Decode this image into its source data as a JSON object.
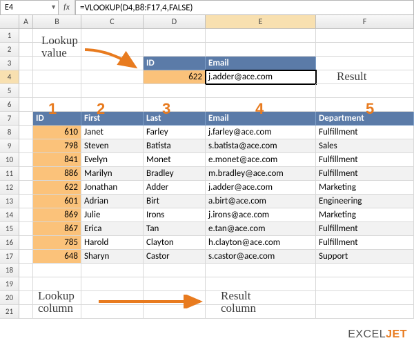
{
  "name_box": "E4",
  "fx_label": "fx",
  "formula": "=VLOOKUP(D4,B8:F17,4,FALSE)",
  "columns": [
    "A",
    "B",
    "C",
    "D",
    "E",
    "F"
  ],
  "row_count": 21,
  "active_col": "E",
  "active_row": 4,
  "lookup_header": {
    "id": "ID",
    "email": "Email"
  },
  "lookup_value": "622",
  "lookup_result": "j.adder@ace.com",
  "col_numbers": [
    "1",
    "2",
    "3",
    "4",
    "5"
  ],
  "table": {
    "headers": [
      "ID",
      "First",
      "Last",
      "Email",
      "Department"
    ],
    "rows": [
      {
        "id": "610",
        "first": "Janet",
        "last": "Farley",
        "email": "j.farley@ace.com",
        "dept": "Fulfillment"
      },
      {
        "id": "798",
        "first": "Steven",
        "last": "Batista",
        "email": "s.batista@ace.com",
        "dept": "Sales"
      },
      {
        "id": "841",
        "first": "Evelyn",
        "last": "Monet",
        "email": "e.monet@ace.com",
        "dept": "Fulfillment"
      },
      {
        "id": "886",
        "first": "Marilyn",
        "last": "Bradley",
        "email": "m.bradley@ace.com",
        "dept": "Fulfillment"
      },
      {
        "id": "622",
        "first": "Jonathan",
        "last": "Adder",
        "email": "j.adder@ace.com",
        "dept": "Marketing"
      },
      {
        "id": "601",
        "first": "Adrian",
        "last": "Birt",
        "email": "a.birt@ace.com",
        "dept": "Engineering"
      },
      {
        "id": "869",
        "first": "Julie",
        "last": "Irons",
        "email": "j.irons@ace.com",
        "dept": "Marketing"
      },
      {
        "id": "867",
        "first": "Erica",
        "last": "Tan",
        "email": "e.tan@ace.com",
        "dept": "Fulfillment"
      },
      {
        "id": "785",
        "first": "Harold",
        "last": "Clayton",
        "email": "h.clayton@ace.com",
        "dept": "Fulfillment"
      },
      {
        "id": "648",
        "first": "Sharyn",
        "last": "Castor",
        "email": "s.castor@ace.com",
        "dept": "Support"
      }
    ]
  },
  "annotations": {
    "lookup_value": "Lookup\nvalue",
    "result": "Result",
    "lookup_column": "Lookup\ncolumn",
    "result_column": "Result\ncolumn"
  },
  "logo": {
    "part1": "EXCEL",
    "part2": "JET"
  }
}
